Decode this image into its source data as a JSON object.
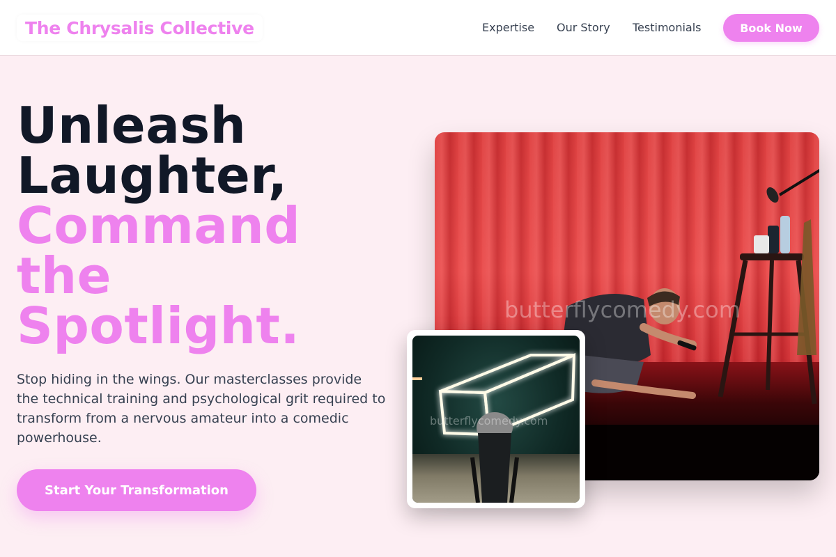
{
  "header": {
    "logo": "The Chrysalis Collective",
    "nav": [
      "Expertise",
      "Our Story",
      "Testimonials"
    ],
    "book_label": "Book Now"
  },
  "hero": {
    "headline_dark": [
      "Unleash",
      "Laughter,"
    ],
    "headline_pink": [
      "Command",
      "the",
      "Spotlight."
    ],
    "subtext": "Stop hiding in the wings. Our masterclasses provide the technical training and psychological grit required to transform from a nervous amateur into a comedic powerhouse.",
    "cta_label": "Start Your Transformation"
  },
  "images": {
    "main_watermark": "butterflycomedy.com",
    "inset_watermark": "butterflycomedy.com"
  },
  "colors": {
    "accent": "#ee82ee",
    "background": "#fdeef3",
    "text_dark": "#111827"
  }
}
